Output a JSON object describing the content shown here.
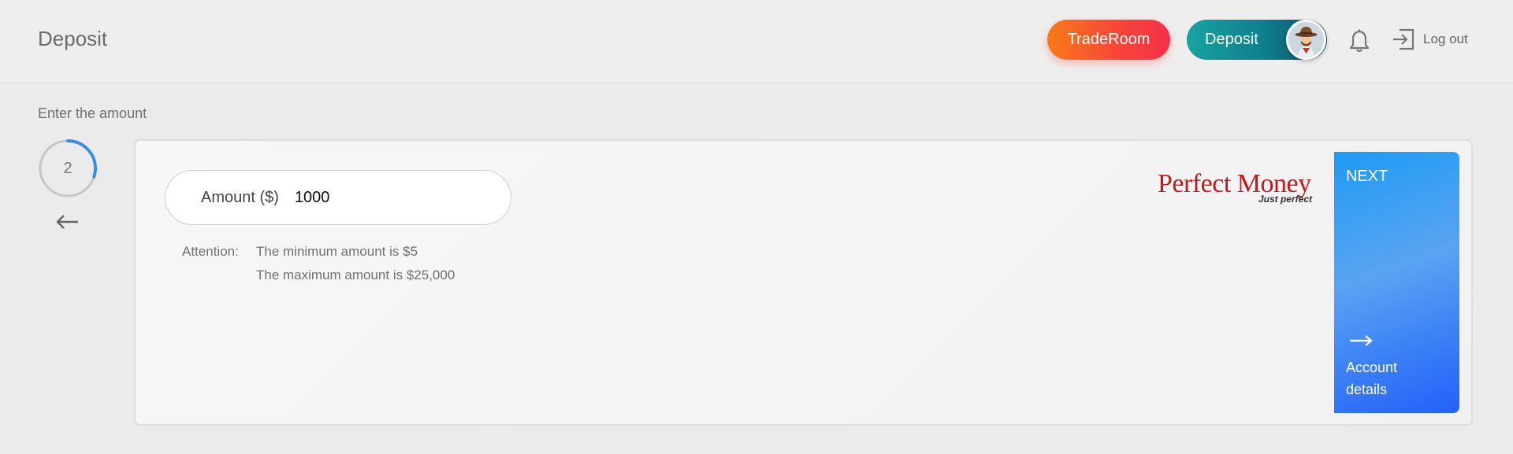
{
  "header": {
    "title": "Deposit",
    "traderoom_label": "TradeRoom",
    "deposit_label": "Deposit",
    "logout_label": "Log out"
  },
  "step": {
    "label": "Enter the amount",
    "number": "2",
    "progress": 0.3
  },
  "form": {
    "amount_label": "Amount ($)",
    "amount_value": "1000",
    "attention_label": "Attention:",
    "min_note": "The minimum amount is $5",
    "max_note": "The maximum amount is $25,000"
  },
  "payment_method": {
    "name": "Perfect Money",
    "tagline": "Just perfect"
  },
  "next": {
    "label": "NEXT",
    "sub_label": "Account details"
  },
  "colors": {
    "traderoom": "#f7443a",
    "deposit": "#0f7f8c",
    "next": "#2460fb",
    "progress": "#3a8ee6",
    "logo": "#c01a1f"
  }
}
